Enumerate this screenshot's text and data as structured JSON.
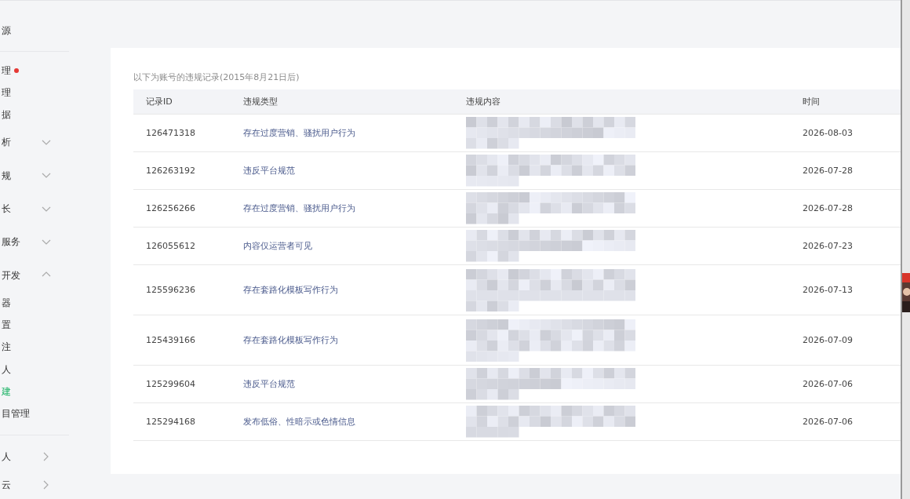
{
  "sidebar": {
    "items": [
      {
        "label": "源",
        "kind": "item",
        "dot": false,
        "selected": false
      },
      {
        "kind": "divider"
      },
      {
        "label": "理",
        "kind": "item",
        "dot": true,
        "selected": false
      },
      {
        "label": "理",
        "kind": "item",
        "dot": false,
        "selected": false
      },
      {
        "label": "据",
        "kind": "item",
        "dot": false,
        "selected": false
      },
      {
        "label": "析",
        "kind": "group",
        "expanded": false
      },
      {
        "label": "规",
        "kind": "group",
        "expanded": false
      },
      {
        "label": "长",
        "kind": "group",
        "expanded": false
      },
      {
        "label": "服务",
        "kind": "group",
        "expanded": false
      },
      {
        "label": "开发",
        "kind": "group",
        "expanded": true,
        "children": [
          {
            "label": "器",
            "kind": "item",
            "dot": false,
            "selected": false
          },
          {
            "label": "置",
            "kind": "item",
            "dot": false,
            "selected": false
          },
          {
            "label": "注",
            "kind": "item",
            "dot": false,
            "selected": false
          },
          {
            "label": "人",
            "kind": "item",
            "dot": false,
            "selected": false
          },
          {
            "label": "建",
            "kind": "item",
            "dot": false,
            "selected": true
          },
          {
            "label": "目管理",
            "kind": "item",
            "dot": false,
            "selected": false
          }
        ]
      },
      {
        "kind": "divider"
      },
      {
        "label": "人",
        "kind": "link"
      },
      {
        "label": "云",
        "kind": "link"
      }
    ]
  },
  "card": {
    "caption": "以下为账号的违规记录(2015年8月21日后)",
    "table": {
      "columns": [
        "记录ID",
        "违规类型",
        "违规内容",
        "时间"
      ],
      "rows": [
        {
          "id": "126471318",
          "type": "存在过度营销、骚扰用户行为",
          "time": "2026-08-03"
        },
        {
          "id": "126263192",
          "type": "违反平台规范",
          "time": "2026-07-28"
        },
        {
          "id": "126256266",
          "type": "存在过度营销、骚扰用户行为",
          "time": "2026-07-28"
        },
        {
          "id": "126055612",
          "type": "内容仅运营者可见",
          "time": "2026-07-23"
        },
        {
          "id": "125596236",
          "type": "存在套路化模板写作行为",
          "time": "2026-07-13"
        },
        {
          "id": "125439166",
          "type": "存在套路化模板写作行为",
          "time": "2026-07-09"
        },
        {
          "id": "125299604",
          "type": "违反平台规范",
          "time": "2026-07-06"
        },
        {
          "id": "125294168",
          "type": "发布低俗、性暗示或色情信息",
          "time": "2026-07-06"
        }
      ]
    }
  }
}
